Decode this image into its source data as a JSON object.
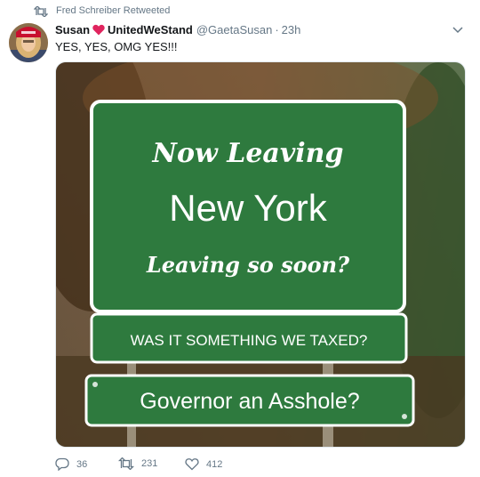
{
  "retweet_banner": {
    "text": "Fred Schreiber Retweeted",
    "icon": "retweet-icon"
  },
  "tweet": {
    "display_name": "Susan",
    "display_name_suffix": "UnitedWeStand",
    "handle": "@GaetaSusan",
    "separator": "·",
    "time": "23h",
    "text": "YES, YES, OMG YES!!!"
  },
  "sign": {
    "line1": "Now Leaving",
    "line2": "New York",
    "line3": "Leaving so soon?",
    "line4": "WAS IT SOMETHING WE TAXED?",
    "line5": "Governor an Asshole?"
  },
  "actions": {
    "reply_count": "36",
    "retweet_count": "231",
    "like_count": "412"
  },
  "colors": {
    "sign_green": "#2e7a3e",
    "heart_red": "#e0245e",
    "muted": "#657786"
  }
}
